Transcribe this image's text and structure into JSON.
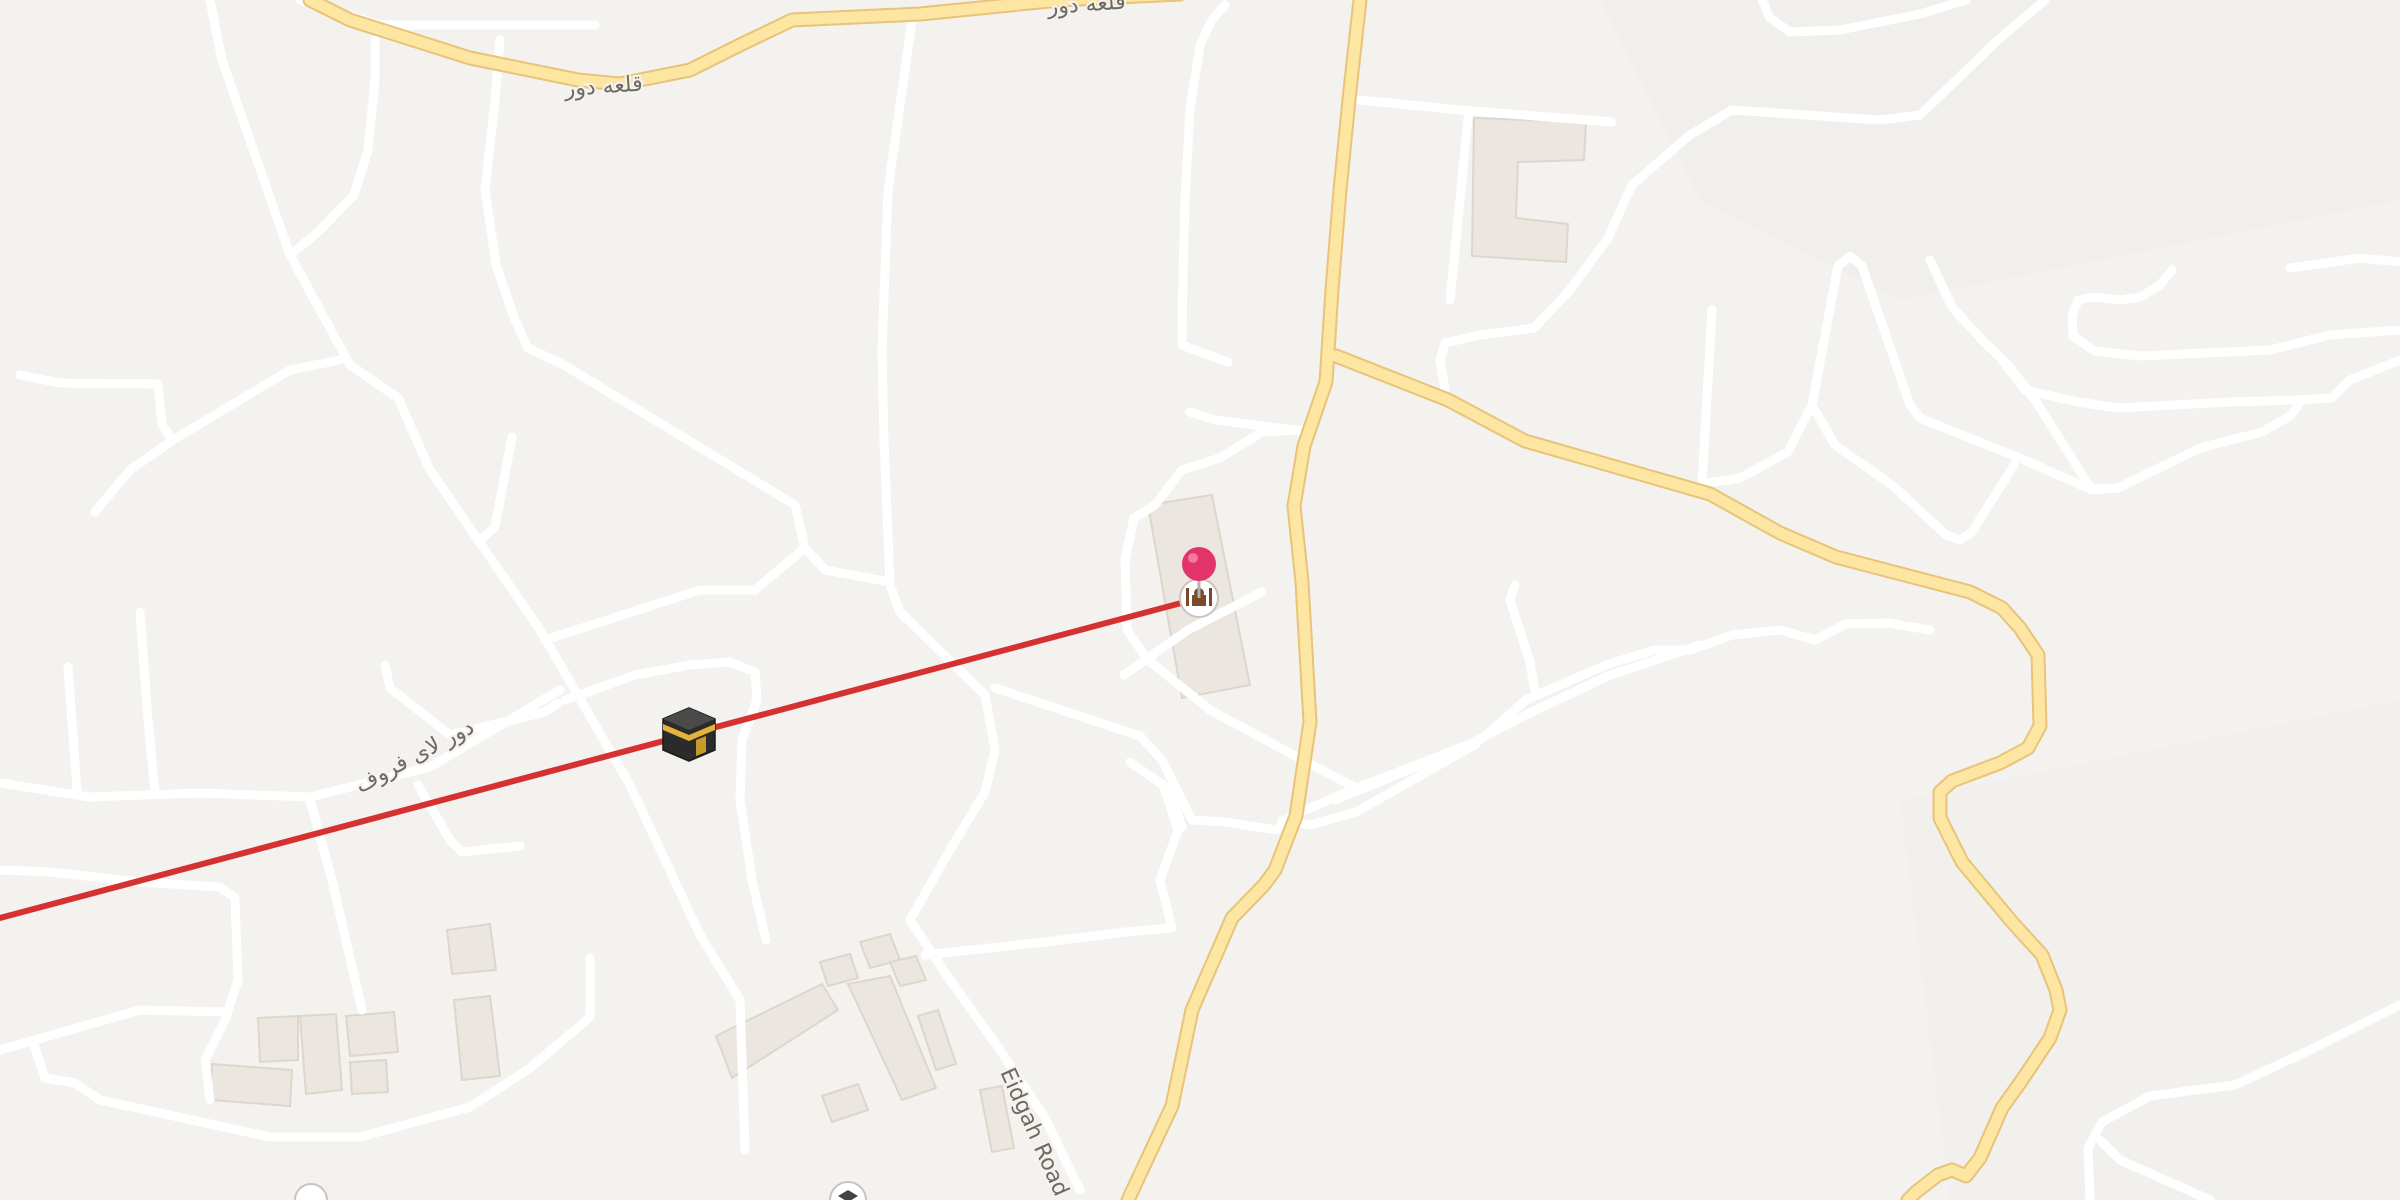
{
  "map": {
    "road_labels": [
      {
        "id": "qala-road",
        "text": "قلعه دور"
      },
      {
        "id": "qala-road-top",
        "text": "قلعه دور"
      },
      {
        "id": "lower-road",
        "text": "دور لای فروف"
      },
      {
        "id": "eidgah-road",
        "text": "Eidgah Road"
      }
    ],
    "markers": {
      "pin_color": "#e2336b",
      "line_color": "#d63131",
      "kaaba_icon": "kaaba-icon",
      "mosque_icon": "mosque-icon"
    },
    "colors": {
      "background": "#f4f2ef",
      "minor_road": "#ffffff",
      "major_road": "#fde6a2",
      "major_road_casing": "#e8c37a",
      "building": "#ebe6df"
    }
  }
}
